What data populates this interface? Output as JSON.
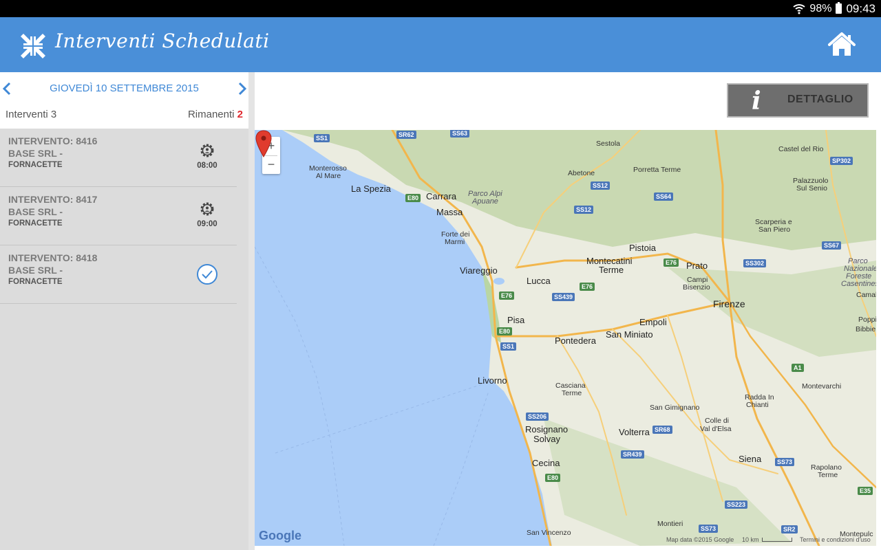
{
  "status_bar": {
    "battery": "98%",
    "time": "09:43"
  },
  "app": {
    "title": "Interventi Schedulati"
  },
  "date_nav": {
    "date": "GIOVEDÌ 10 SETTEMBRE 2015"
  },
  "counts": {
    "interventi_label": "Interventi 3",
    "rimanenti_label": "Rimanenti",
    "rimanenti_value": "2"
  },
  "interventions": [
    {
      "title": "INTERVENTO: 8416",
      "client": "BASE SRL -",
      "location": "FORNACETTE",
      "time": "08:00",
      "status": "scheduled-gear-icon"
    },
    {
      "title": "INTERVENTO: 8417",
      "client": "BASE SRL -",
      "location": "FORNACETTE",
      "time": "09:00",
      "status": "scheduled-gear-icon"
    },
    {
      "title": "INTERVENTO: 8418",
      "client": "BASE SRL -",
      "location": "FORNACETTE",
      "time": "",
      "status": "completed-check-icon"
    }
  ],
  "detail_button": {
    "label": "DETTAGLIO",
    "icon": "info-icon"
  },
  "map": {
    "zoom_in": "+",
    "zoom_out": "−",
    "cities": {
      "sestola": "Sestola",
      "castel_del_rio": "Castel del Rio",
      "monterosso": "Monterosso",
      "al_mare": "Al Mare",
      "la_spezia": "La Spezia",
      "abetone": "Abetone",
      "porretta": "Porretta Terme",
      "palazzuolo": "Palazzuolo",
      "sul_senio": "Sul Senio",
      "carrara": "Carrara",
      "parco_alpi": "Parco Alpi",
      "apuane": "Apuane",
      "massa": "Massa",
      "scarperia": "Scarperia e",
      "san_piero": "San Piero",
      "forte_dei": "Forte dei",
      "marmi": "Marmi",
      "pistoia": "Pistoia",
      "montecatini": "Montecatini",
      "terme": "Terme",
      "prato": "Prato",
      "parco": "Parco",
      "nazionale": "Nazionale",
      "foreste": "Foreste",
      "casentinesi": "Casentinesi",
      "viareggio": "Viareggio",
      "campi": "Campi",
      "bisenzio": "Bisenzio",
      "lucca": "Lucca",
      "camal": "Camal",
      "firenze": "Firenze",
      "poppi": "Poppi",
      "bibbie": "Bibbie",
      "pisa": "Pisa",
      "empoli": "Empoli",
      "pontedera": "Pontedera",
      "san_miniato": "San Miniato",
      "livorno": "Livorno",
      "montevarchi": "Montevarchi",
      "casciana": "Casciana",
      "casciana_terme": "Terme",
      "radda": "Radda In",
      "chianti": "Chianti",
      "san_gimignano": "San Gimignano",
      "colle": "Colle di",
      "val_elsa": "Val d'Elsa",
      "rosignano": "Rosignano",
      "solvay": "Solvay",
      "volterra": "Volterra",
      "siena": "Siena",
      "rapolano": "Rapolano",
      "rapolano_terme": "Terme",
      "cecina": "Cecina",
      "montieri": "Montieri",
      "san_vincenzo": "San Vincenzo",
      "montepulc": "Montepulc"
    },
    "roads": {
      "ss1_top": "SS1",
      "sr62": "SR62",
      "ss63": "SS63",
      "sp302": "SP302",
      "ss12a": "SS12",
      "ss64": "SS64",
      "e80a": "E80",
      "ss12b": "SS12",
      "ss67": "SS67",
      "e76a": "E76",
      "ss302": "SS302",
      "e76b": "E76",
      "ss439": "SS439",
      "e76c": "E76",
      "e80b": "E80",
      "ss1": "SS1",
      "a1": "A1",
      "ss206": "SS206",
      "sr68": "SR68",
      "sr439": "SR439",
      "ss73": "SS73",
      "e80c": "E80",
      "ss223": "SS223",
      "e35": "E35",
      "ss73b": "SS73",
      "sr2": "SR2"
    },
    "google": "Google",
    "map_data": "Map data ©2015 Google",
    "scale": "10 km",
    "terms": "Termini e condizioni d'uso"
  }
}
